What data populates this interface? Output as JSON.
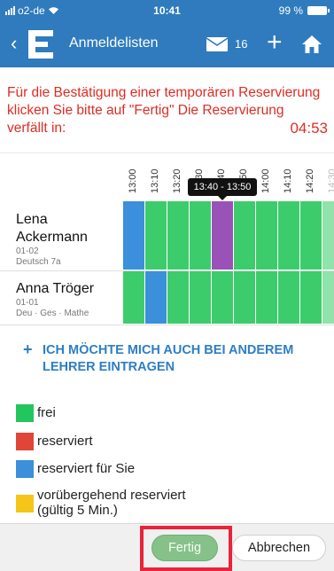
{
  "status_bar": {
    "carrier": "o2-de",
    "time": "10:41",
    "battery": "99 %"
  },
  "nav": {
    "back_icon": "chevron-left",
    "logo_letter": "E",
    "title": "Anmeldelisten",
    "mail_count": "16",
    "plus": "+"
  },
  "notice": {
    "text": "Für die Bestätigung einer temporären Reservierung klicken Sie bitte auf \"Fertig\" Die Reservierung verfällt in:",
    "countdown": "04:53"
  },
  "schedule": {
    "times": [
      "13:00",
      "13:10",
      "13:20",
      "13:30",
      "13:40",
      "13:50",
      "14:00",
      "14:10",
      "14:20",
      "14:30"
    ],
    "tooltip": "13:40 - 13:50",
    "rows": [
      {
        "name_line1": "Lena",
        "name_line2": "Ackermann",
        "room": "01-02",
        "subject": "Deutsch 7a",
        "slots": [
          "blue",
          "green",
          "green",
          "green",
          "purple",
          "green",
          "green",
          "green",
          "green",
          "green"
        ]
      },
      {
        "name_line1": "Anna Tröger",
        "room": "01-01",
        "subject": "Deu · Ges · Mathe",
        "slots": [
          "green",
          "blue",
          "green",
          "green",
          "green",
          "green",
          "green",
          "green",
          "green",
          "green"
        ]
      }
    ]
  },
  "more_link": {
    "text": "ICH MÖCHTE MICH AUCH BEI ANDEREM LEHRER EINTRAGEN"
  },
  "legend": {
    "items": [
      {
        "label": "frei",
        "color": "#22c55e"
      },
      {
        "label": "reserviert",
        "color": "#e0453a"
      },
      {
        "label": "reserviert für Sie",
        "color": "#3b8fdb"
      },
      {
        "label": "vorübergehend reserviert (gültig 5 Min.)",
        "color": "#f5c518"
      }
    ]
  },
  "buttons": {
    "ok": "Fertig",
    "cancel": "Abbrechen"
  },
  "colors": {
    "green": "#3dcc6c",
    "blue": "#3b8fdb",
    "purple": "#9b52b8",
    "nav": "#2f7bbd",
    "accent": "#e8233a"
  }
}
